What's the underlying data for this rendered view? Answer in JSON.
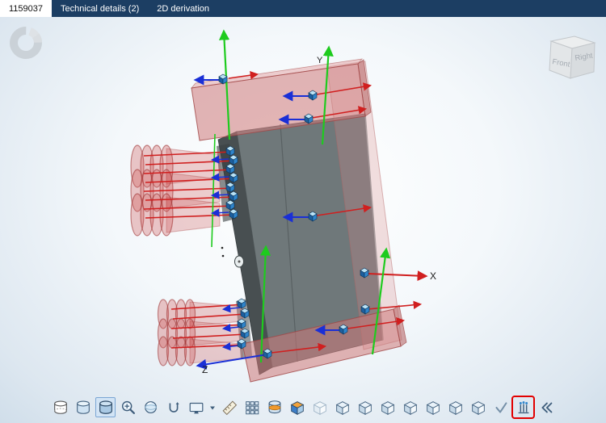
{
  "tabs": [
    {
      "label": "1159037",
      "active": true
    },
    {
      "label": "Technical details (2)",
      "active": false
    },
    {
      "label": "2D derivation",
      "active": false
    }
  ],
  "viewcube": {
    "front_label": "Front",
    "right_label": "Right"
  },
  "axis_labels": {
    "x": "X",
    "y": "Y",
    "z": "Z"
  },
  "toolbar": {
    "items": [
      {
        "name": "cylinder-wireframe-view",
        "active": false
      },
      {
        "name": "cylinder-shaded-view",
        "active": false
      },
      {
        "name": "cylinder-shaded-edges-view",
        "active": true
      },
      {
        "name": "zoom",
        "active": false
      },
      {
        "name": "render-sphere",
        "active": false
      },
      {
        "name": "rotate-tool",
        "active": false
      },
      {
        "name": "fit-to-screen",
        "active": false,
        "has_dropdown": true
      },
      {
        "name": "measure-ruler",
        "active": false
      },
      {
        "name": "grid",
        "active": false
      },
      {
        "name": "section-cylinder",
        "active": false
      },
      {
        "name": "colored-cube-view",
        "active": false
      },
      {
        "name": "cube-transparent-view",
        "active": false
      },
      {
        "name": "cube-view-1",
        "active": false
      },
      {
        "name": "cube-view-2",
        "active": false
      },
      {
        "name": "cube-view-3",
        "active": false
      },
      {
        "name": "cube-view-4",
        "active": false
      },
      {
        "name": "cube-view-5",
        "active": false
      },
      {
        "name": "cube-view-6",
        "active": false
      },
      {
        "name": "cube-view-7",
        "active": false
      },
      {
        "name": "checkmark-view",
        "active": false
      },
      {
        "name": "connection-points",
        "active": false,
        "highlighted": true
      },
      {
        "name": "flip-arrows",
        "active": false
      }
    ]
  },
  "colors": {
    "tab_bar": "#1c3e63",
    "active_tab_bg": "#ffffff",
    "model_body_gray": "#6f787a",
    "clamp_red": "#c97f7f",
    "axis_x_red": "#d01f1f",
    "axis_y_green": "#1ecb1e",
    "axis_z_blue": "#1a2fd6",
    "connector_blue": "#2f85cc",
    "highlight_border": "#e20000"
  }
}
